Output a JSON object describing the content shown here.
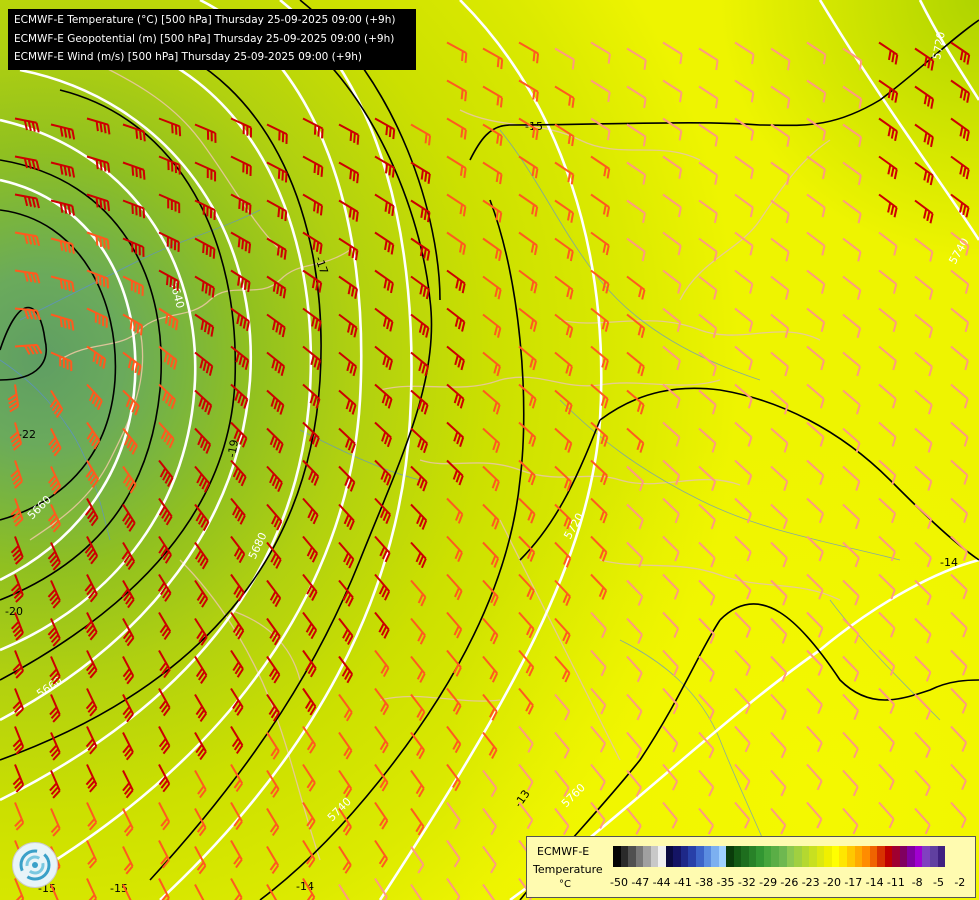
{
  "header": {
    "lines": [
      "ECMWF-E Temperature (°C) [500 hPa] Thursday 25-09-2025 09:00 (+9h)",
      "ECMWF-E Geopotential (m) [500 hPa] Thursday 25-09-2025 09:00 (+9h)",
      "ECMWF-E Wind (m/s) [500 hPa] Thursday 25-09-2025 09:00 (+9h)"
    ]
  },
  "legend": {
    "source": "ECMWF-E",
    "variable": "Temperature",
    "unit": "°C",
    "tick_labels": [
      "-50",
      "-47",
      "-44",
      "-41",
      "-38",
      "-35",
      "-32",
      "-29",
      "-26",
      "-23",
      "-20",
      "-17",
      "-14",
      "-11",
      "-8",
      "-5",
      "-2"
    ],
    "colors": [
      "#050505",
      "#2a2a2a",
      "#505050",
      "#787878",
      "#a0a0a0",
      "#c8c8c8",
      "#f0f0f0",
      "#0a0a40",
      "#141464",
      "#1e2888",
      "#2840a8",
      "#3c64c8",
      "#5a8ce0",
      "#7cb0f0",
      "#a0d0ff",
      "#0a3c0a",
      "#145a14",
      "#1e6e1e",
      "#288228",
      "#329632",
      "#46a63c",
      "#5aae46",
      "#6eb850",
      "#8cc850",
      "#a0d040",
      "#b4d830",
      "#c8e020",
      "#dce810",
      "#f0f000",
      "#ffff00",
      "#ffe600",
      "#ffc800",
      "#ffaa00",
      "#ff8c00",
      "#f06400",
      "#d83200",
      "#c00000",
      "#a00030",
      "#800060",
      "#8000a0",
      "#a000d0",
      "#8040c0",
      "#6040a0",
      "#402080"
    ]
  },
  "map": {
    "contour_labels_geopotential": [
      "5640",
      "5660",
      "5680",
      "5660",
      "5720",
      "5740",
      "5760",
      "5720",
      "5740"
    ],
    "contour_labels_temperature": [
      "-15",
      "-17",
      "-19",
      "-20",
      "-22",
      "-14",
      "-13",
      "-14",
      "-15",
      "-15"
    ],
    "style": {
      "geopotential_color": "#ffffff",
      "temperature_color": "#000000",
      "wind_colors": [
        "#cc0000",
        "#ff5a1e",
        "#ff9a80"
      ],
      "border_color": "#e8c8a0"
    }
  },
  "logo": {
    "icon": "ecmwf-swirl-icon"
  }
}
